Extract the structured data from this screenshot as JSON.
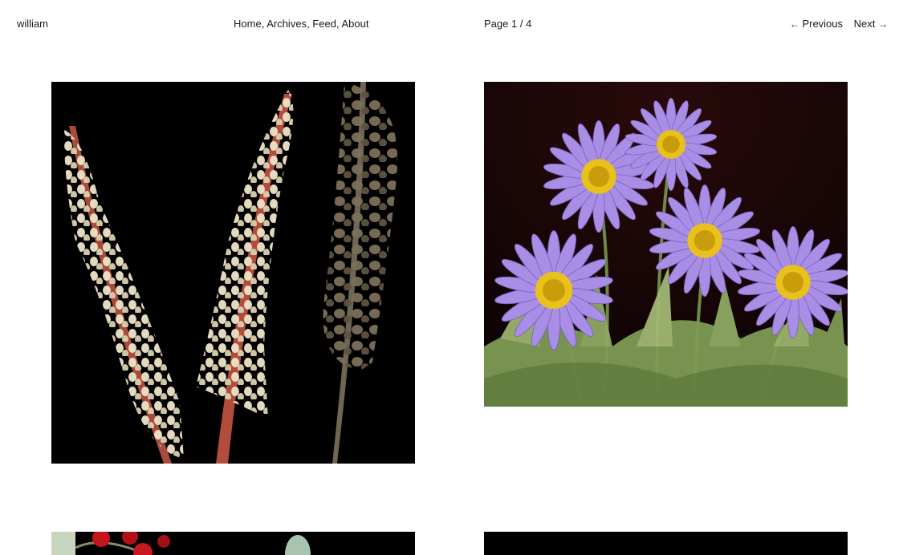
{
  "site": {
    "name": "william"
  },
  "nav": {
    "items": [
      {
        "label": "Home"
      },
      {
        "label": "Archives"
      },
      {
        "label": "Feed"
      },
      {
        "label": "About"
      }
    ]
  },
  "pagination": {
    "page_label": "Page",
    "current": "1",
    "separator": "/",
    "total": "4",
    "previous_label": "Previous",
    "next_label": "Next",
    "previous_icon": "arrow-left-icon",
    "next_icon": "arrow-right-icon"
  },
  "gallery": {
    "photos": [
      {
        "subject": "pinedrops-flower-spikes",
        "background": "#000000"
      },
      {
        "subject": "purple-asters",
        "background": "#170607"
      },
      {
        "subject": "red-berries",
        "background": "#000000"
      },
      {
        "subject": "dark-botanical",
        "background": "#000000"
      }
    ]
  },
  "colors": {
    "text": "#1a1a1a",
    "background": "#ffffff"
  }
}
